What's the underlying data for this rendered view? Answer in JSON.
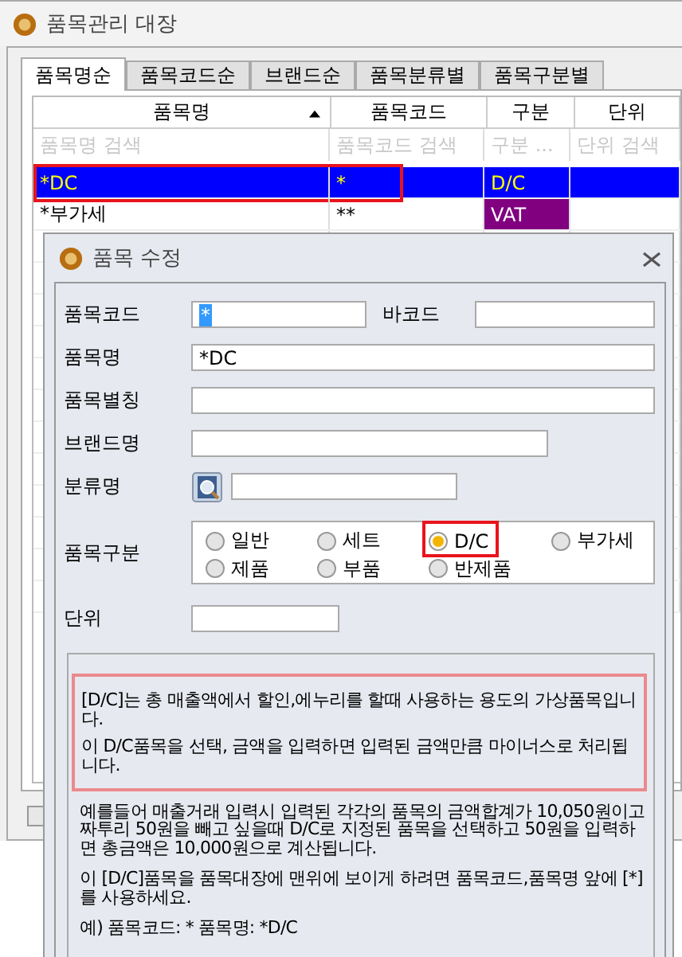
{
  "window": {
    "title": "품목관리 대장"
  },
  "tabs": [
    {
      "label": "품목명순",
      "selected": true
    },
    {
      "label": "품목코드순",
      "selected": false
    },
    {
      "label": "브랜드순",
      "selected": false
    },
    {
      "label": "품목분류별",
      "selected": false
    },
    {
      "label": "품목구분별",
      "selected": false
    }
  ],
  "table": {
    "columns": [
      {
        "label": "품목명",
        "placeholder": "품목명 검색",
        "sorted": true
      },
      {
        "label": "품목코드",
        "placeholder": "품목코드 검색",
        "sorted": false
      },
      {
        "label": "구분",
        "placeholder": "구분 ...",
        "sorted": false
      },
      {
        "label": "단위",
        "placeholder": "단위 검색",
        "sorted": false
      }
    ],
    "rows": [
      {
        "name": "*DC",
        "code": "*",
        "type": "D/C",
        "color": "#0000ff",
        "selected": true,
        "highlighted": true
      },
      {
        "name": "*부가세",
        "code": "**",
        "type": "VAT",
        "color": "#800080",
        "selected": false,
        "highlighted": false
      }
    ]
  },
  "bottom_checkbox": {
    "checked": false
  },
  "dialog": {
    "title": "품목 수정",
    "code_field": {
      "label": "품목코드",
      "value": "*",
      "text_selected": true
    },
    "barcode_field": {
      "label": "바코드"
    },
    "name_field": {
      "label": "품목명",
      "value": "*DC"
    },
    "alias_field": {
      "label": "품목별칭"
    },
    "brand_field": {
      "label": "브랜드명"
    },
    "category_field": {
      "label": "분류명"
    },
    "type_group": {
      "label": "품목구분",
      "options": [
        {
          "label": "일반",
          "selected": false,
          "highlighted": false
        },
        {
          "label": "세트",
          "selected": false,
          "highlighted": false
        },
        {
          "label": "D/C",
          "selected": true,
          "highlighted": true
        },
        {
          "label": "부가세",
          "selected": false,
          "highlighted": false
        },
        {
          "label": "제품",
          "selected": false,
          "highlighted": false
        },
        {
          "label": "부품",
          "selected": false,
          "highlighted": false
        },
        {
          "label": "반제품",
          "selected": false,
          "highlighted": false
        }
      ]
    },
    "unit_field": {
      "label": "단위"
    },
    "highlighted_notes": [
      "[D/C]는 총 매출액에서 할인,에누리를 할때 사용하는 용도의 가상품목입니다.",
      "이 D/C품목을 선택, 금액을 입력하면 입력된 금액만큼 마이너스로 처리됩니다."
    ],
    "notes": [
      "예를들어 매출거래 입력시 입력된 각각의 품목의 금액합계가 10,050원이고 짜투리 50원을 빼고 싶을때 D/C로 지정된 품목을 선택하고 50원을 입력하면 총금액은 10,000원으로 계산됩니다.",
      "이 [D/C]품목을 품목대장에 맨위에 보이게 하려면 품목코드,품목명 앞에 [*]를 사용하세요.",
      "예) 품목코드: *   품목명: *D/C"
    ]
  }
}
